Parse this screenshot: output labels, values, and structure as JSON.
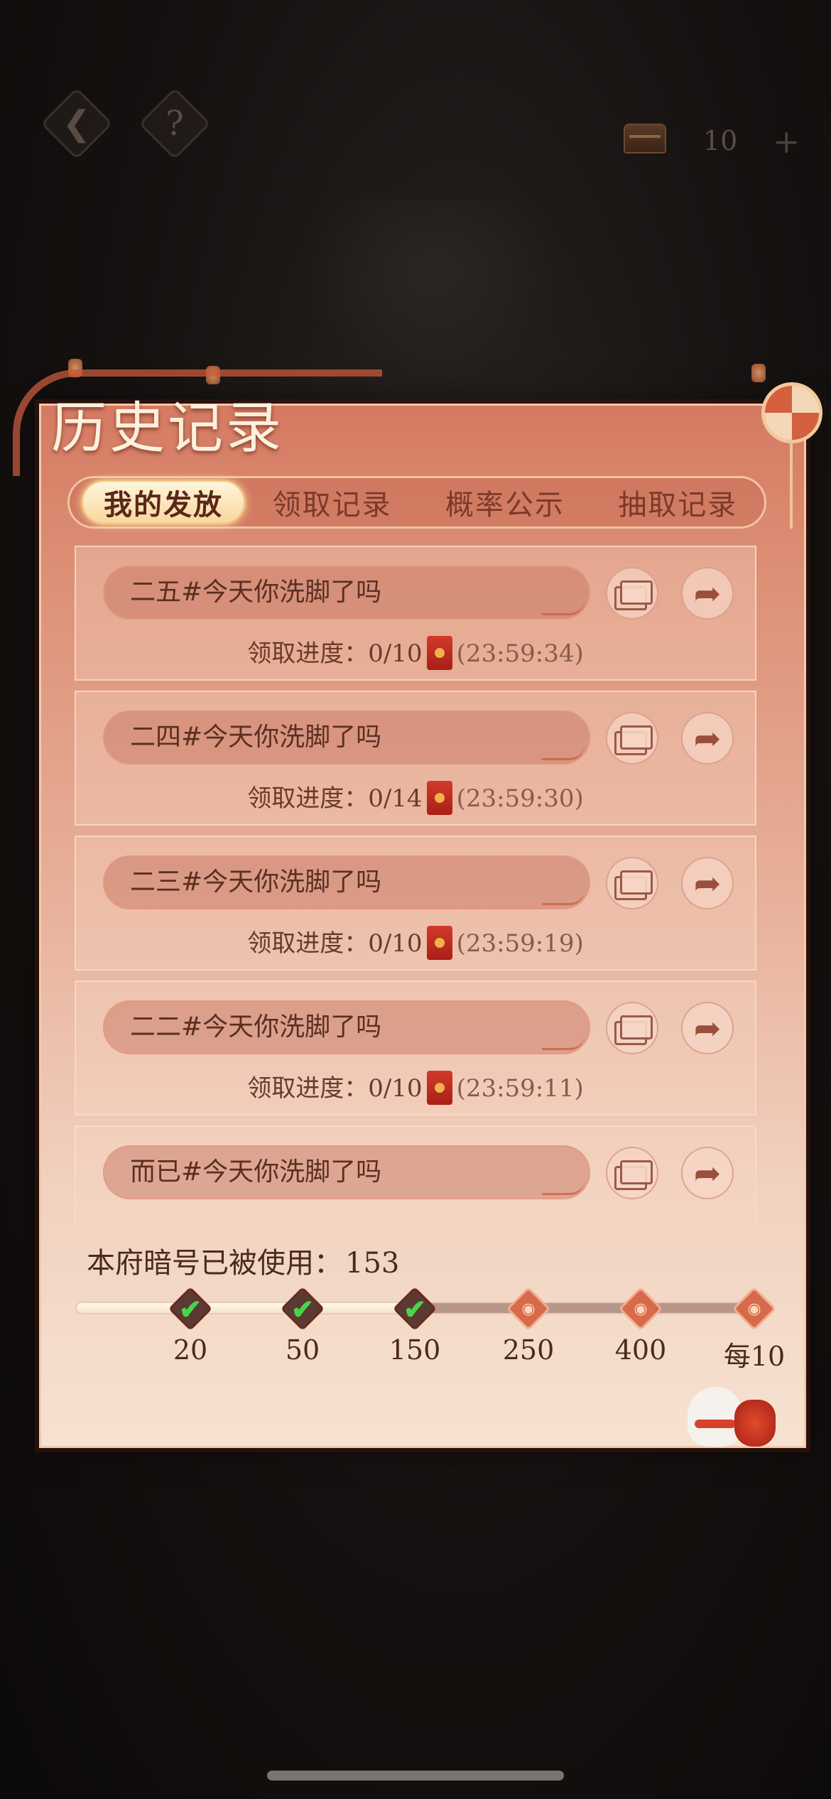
{
  "topbar": {
    "back_icon": "back-arrow-icon",
    "help_label": "?",
    "currency_count": "10",
    "plus_label": "+"
  },
  "panel": {
    "title": "历史记录",
    "tabs": [
      {
        "label": "我的发放",
        "active": true
      },
      {
        "label": "领取记录",
        "active": false
      },
      {
        "label": "概率公示",
        "active": false
      },
      {
        "label": "抽取记录",
        "active": false
      }
    ]
  },
  "records": [
    {
      "name": "二五#今天你洗脚了吗",
      "progress_label": "领取进度：",
      "progress": "0/10",
      "time": "(23:59:34)"
    },
    {
      "name": "二四#今天你洗脚了吗",
      "progress_label": "领取进度：",
      "progress": "0/14",
      "time": "(23:59:30)"
    },
    {
      "name": "二三#今天你洗脚了吗",
      "progress_label": "领取进度：",
      "progress": "0/10",
      "time": "(23:59:19)"
    },
    {
      "name": "二二#今天你洗脚了吗",
      "progress_label": "领取进度：",
      "progress": "0/10",
      "time": "(23:59:11)"
    },
    {
      "name": "而已#今天你洗脚了吗"
    }
  ],
  "usage": {
    "label": "本府暗号已被使用：",
    "value": "153",
    "fill_fraction": 0.5,
    "milestones": [
      {
        "label": "20",
        "reached": true
      },
      {
        "label": "50",
        "reached": true
      },
      {
        "label": "150",
        "reached": true
      },
      {
        "label": "250",
        "reached": false
      },
      {
        "label": "400",
        "reached": false
      },
      {
        "label": "每10",
        "reached": false
      }
    ]
  },
  "colors": {
    "accent": "#c85a3c",
    "check": "#4bd44a",
    "envelope": "#d23a2a"
  }
}
